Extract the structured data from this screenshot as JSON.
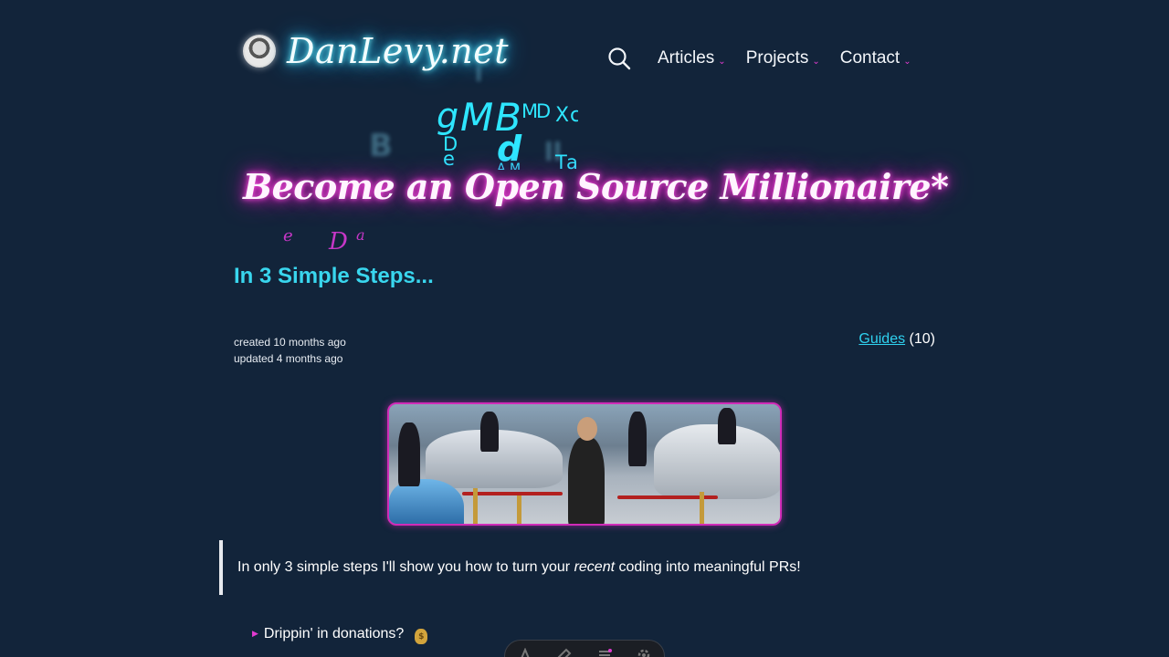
{
  "site": {
    "title": "DanLevy.net"
  },
  "nav": {
    "items": [
      {
        "label": "Articles"
      },
      {
        "label": "Projects"
      },
      {
        "label": "Contact"
      }
    ],
    "search_icon": "search-icon",
    "chevron": "⌄"
  },
  "article": {
    "title": "Become an Open Source Millionaire*",
    "subtitle": "In 3 Simple Steps...",
    "created": "created 10 months ago",
    "updated": "updated 4 months ago",
    "tag": {
      "label": "Guides",
      "count": "(10)"
    },
    "intro": {
      "before": "In only 3 simple steps I'll show you how to turn your ",
      "emphasis": "recent",
      "after": " coding into meaningful PRs!"
    },
    "list": [
      {
        "text": "Drippin' in donations?",
        "icon": "money-bag-icon"
      }
    ]
  },
  "decor": {
    "scramble_cyan": [
      "g",
      "M",
      "B",
      "M",
      "D",
      "X",
      "c",
      "D",
      "e",
      "d",
      "A",
      "M",
      "T",
      "a"
    ],
    "scramble_pink": [
      "e",
      "D",
      "a"
    ]
  },
  "colors": {
    "background": "#12243a",
    "neon_cyan": "#34d8ff",
    "neon_pink": "#e81fc8",
    "accent_cyan": "#39d6ee",
    "accent_pink": "#e23bd0"
  }
}
